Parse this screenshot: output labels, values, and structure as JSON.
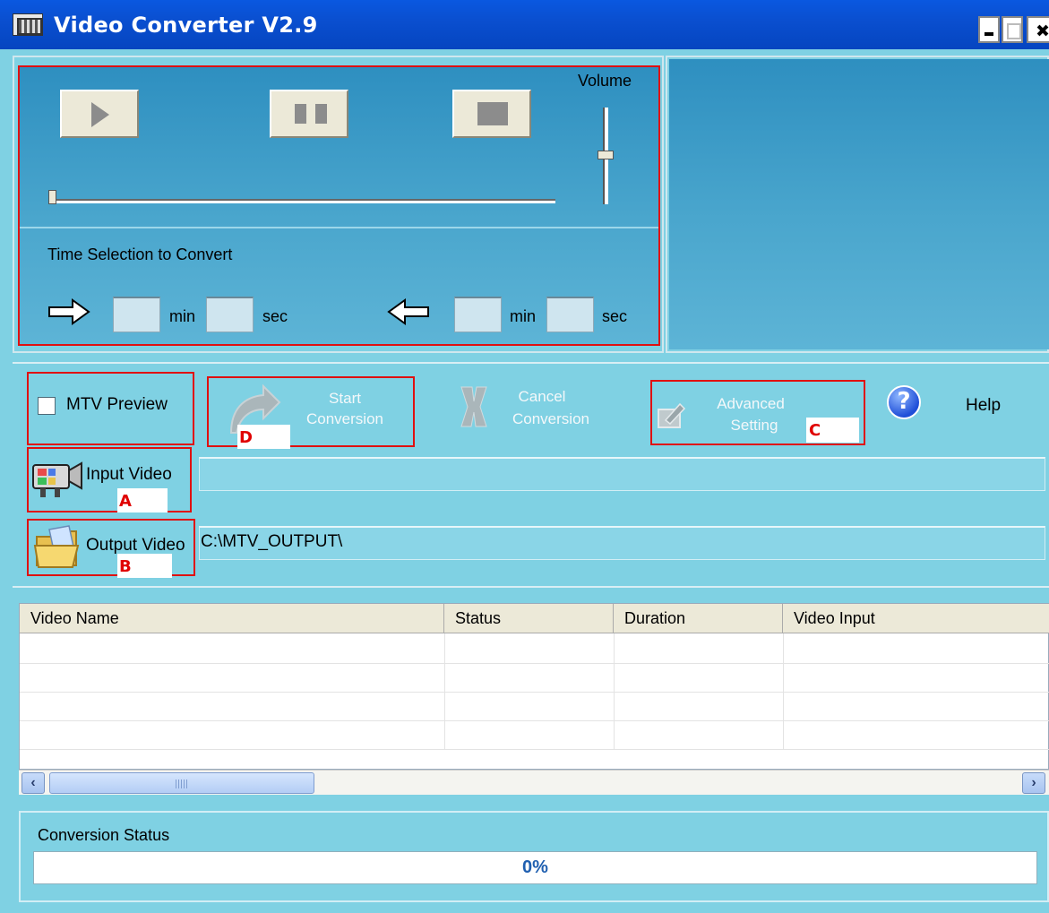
{
  "window": {
    "title": "Video Converter V2.9"
  },
  "player": {
    "volume_label": "Volume",
    "volume_level": 0.55,
    "seek_position": 0.0,
    "time_selection_label": "Time Selection to Convert",
    "start_time": {
      "min": "",
      "sec": "",
      "min_unit": "min",
      "sec_unit": "sec"
    },
    "end_time": {
      "min": "",
      "sec": "",
      "min_unit": "min",
      "sec_unit": "sec"
    }
  },
  "toolbar": {
    "mtv_preview_label": "MTV Preview",
    "mtv_preview_checked": false,
    "start_line1": "Start",
    "start_line2": "Conversion",
    "cancel_line1": "Cancel",
    "cancel_line2": "Conversion",
    "advanced_line1": "Advanced",
    "advanced_line2": "Setting",
    "help_label": "Help"
  },
  "input_video": {
    "label": "Input Video",
    "value": ""
  },
  "output_video": {
    "label": "Output Video",
    "value": "C:\\MTV_OUTPUT\\"
  },
  "annotations": {
    "a": "A",
    "b": "B",
    "c": "C",
    "d": "D"
  },
  "table": {
    "columns": [
      "Video Name",
      "Status",
      "Duration",
      "Video Input"
    ],
    "rows": []
  },
  "status": {
    "label": "Conversion Status",
    "progress_text": "0%",
    "progress": 0
  },
  "colors": {
    "title_bar": "#0a4fd0",
    "panel_bg": "#7fd1e3",
    "annotation_red": "#e01010"
  }
}
